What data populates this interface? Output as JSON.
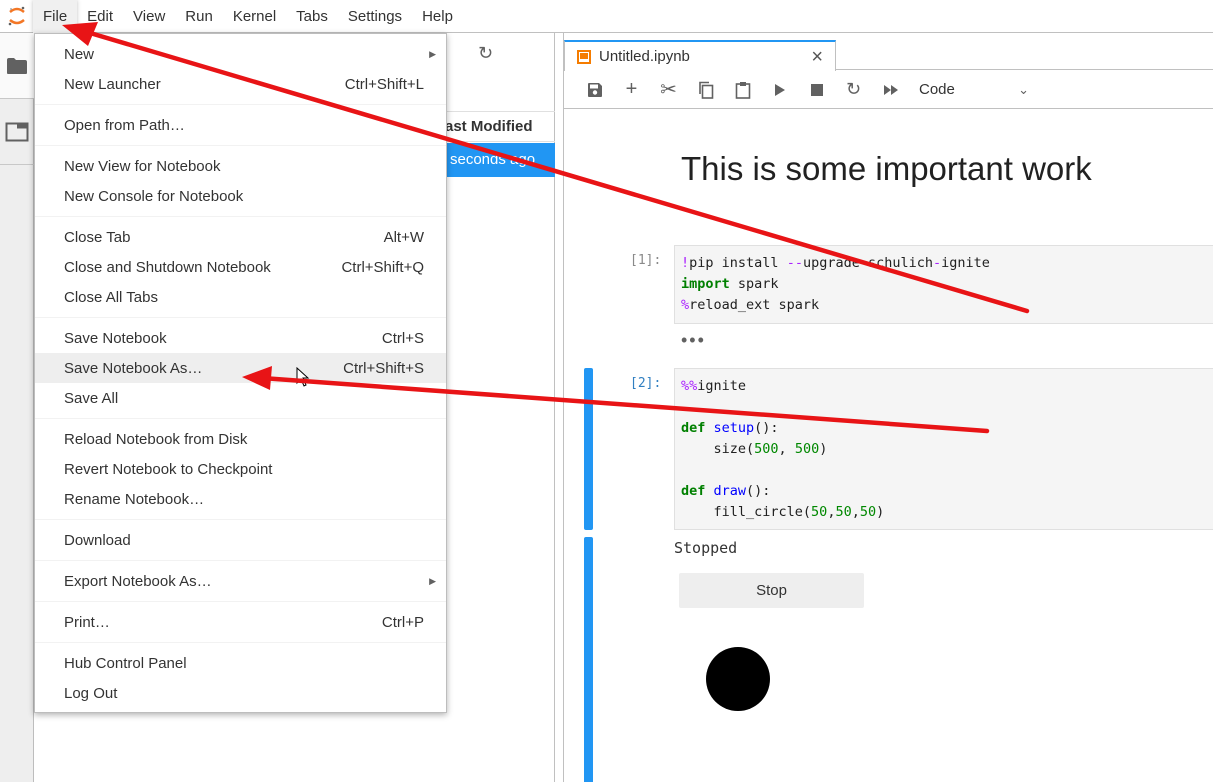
{
  "menubar": {
    "items": [
      "File",
      "Edit",
      "View",
      "Run",
      "Kernel",
      "Tabs",
      "Settings",
      "Help"
    ],
    "active": "File"
  },
  "activitybar": {
    "icons": [
      "folder-icon",
      "tabs-icon"
    ]
  },
  "filebrowser": {
    "column_header": "ast Modified",
    "selected_row_modified": "seconds ago"
  },
  "notebook": {
    "tab_title": "Untitled.ipynb",
    "cell_type": "Code",
    "heading": "This is some important work",
    "cells": [
      {
        "prompt": "[1]:",
        "lines": [
          [
            {
              "t": "!",
              "c": "mg"
            },
            {
              "t": "pip install ",
              "c": ""
            },
            {
              "t": "--",
              "c": "mg"
            },
            {
              "t": "upgrade schulich",
              "c": ""
            },
            {
              "t": "-",
              "c": "mg"
            },
            {
              "t": "ignite",
              "c": ""
            }
          ],
          [
            {
              "t": "import",
              "c": "kw"
            },
            {
              "t": " spark",
              "c": ""
            }
          ],
          [
            {
              "t": "%",
              "c": "mg"
            },
            {
              "t": "reload_ext spark",
              "c": ""
            }
          ]
        ],
        "collapsed_output": "•••"
      },
      {
        "prompt": "[2]:",
        "lines": [
          [
            {
              "t": "%%",
              "c": "mg"
            },
            {
              "t": "ignite",
              "c": ""
            }
          ],
          [],
          [
            {
              "t": "def",
              "c": "kw"
            },
            {
              "t": " ",
              "c": ""
            },
            {
              "t": "setup",
              "c": "fn"
            },
            {
              "t": "():",
              "c": ""
            }
          ],
          [
            {
              "t": "    size(",
              "c": ""
            },
            {
              "t": "500",
              "c": "nm"
            },
            {
              "t": ", ",
              "c": ""
            },
            {
              "t": "500",
              "c": "nm"
            },
            {
              "t": ")",
              "c": ""
            }
          ],
          [],
          [
            {
              "t": "def",
              "c": "kw"
            },
            {
              "t": " ",
              "c": ""
            },
            {
              "t": "draw",
              "c": "fn"
            },
            {
              "t": "():",
              "c": ""
            }
          ],
          [
            {
              "t": "    fill_circle(",
              "c": ""
            },
            {
              "t": "50",
              "c": "nm"
            },
            {
              "t": ",",
              "c": ""
            },
            {
              "t": "50",
              "c": "nm"
            },
            {
              "t": ",",
              "c": ""
            },
            {
              "t": "50",
              "c": "nm"
            },
            {
              "t": ")",
              "c": ""
            }
          ]
        ]
      }
    ],
    "output": {
      "status_text": "Stopped",
      "stop_button": "Stop"
    }
  },
  "file_menu": {
    "groups": [
      [
        {
          "label": "New",
          "shortcut": "",
          "submenu": true
        },
        {
          "label": "New Launcher",
          "shortcut": "Ctrl+Shift+L"
        }
      ],
      [
        {
          "label": "Open from Path…",
          "shortcut": ""
        }
      ],
      [
        {
          "label": "New View for Notebook",
          "shortcut": ""
        },
        {
          "label": "New Console for Notebook",
          "shortcut": ""
        }
      ],
      [
        {
          "label": "Close Tab",
          "shortcut": "Alt+W"
        },
        {
          "label": "Close and Shutdown Notebook",
          "shortcut": "Ctrl+Shift+Q"
        },
        {
          "label": "Close All Tabs",
          "shortcut": ""
        }
      ],
      [
        {
          "label": "Save Notebook",
          "shortcut": "Ctrl+S"
        },
        {
          "label": "Save Notebook As…",
          "shortcut": "Ctrl+Shift+S",
          "hover": true
        },
        {
          "label": "Save All",
          "shortcut": ""
        }
      ],
      [
        {
          "label": "Reload Notebook from Disk",
          "shortcut": ""
        },
        {
          "label": "Revert Notebook to Checkpoint",
          "shortcut": ""
        },
        {
          "label": "Rename Notebook…",
          "shortcut": ""
        }
      ],
      [
        {
          "label": "Download",
          "shortcut": ""
        }
      ],
      [
        {
          "label": "Export Notebook As…",
          "shortcut": "",
          "submenu": true
        }
      ],
      [
        {
          "label": "Print…",
          "shortcut": "Ctrl+P"
        }
      ],
      [
        {
          "label": "Hub Control Panel",
          "shortcut": ""
        },
        {
          "label": "Log Out",
          "shortcut": ""
        }
      ]
    ]
  },
  "colors": {
    "accent": "#2196f3",
    "annotation": "#e81416",
    "notebook_icon": "#f57c00"
  }
}
